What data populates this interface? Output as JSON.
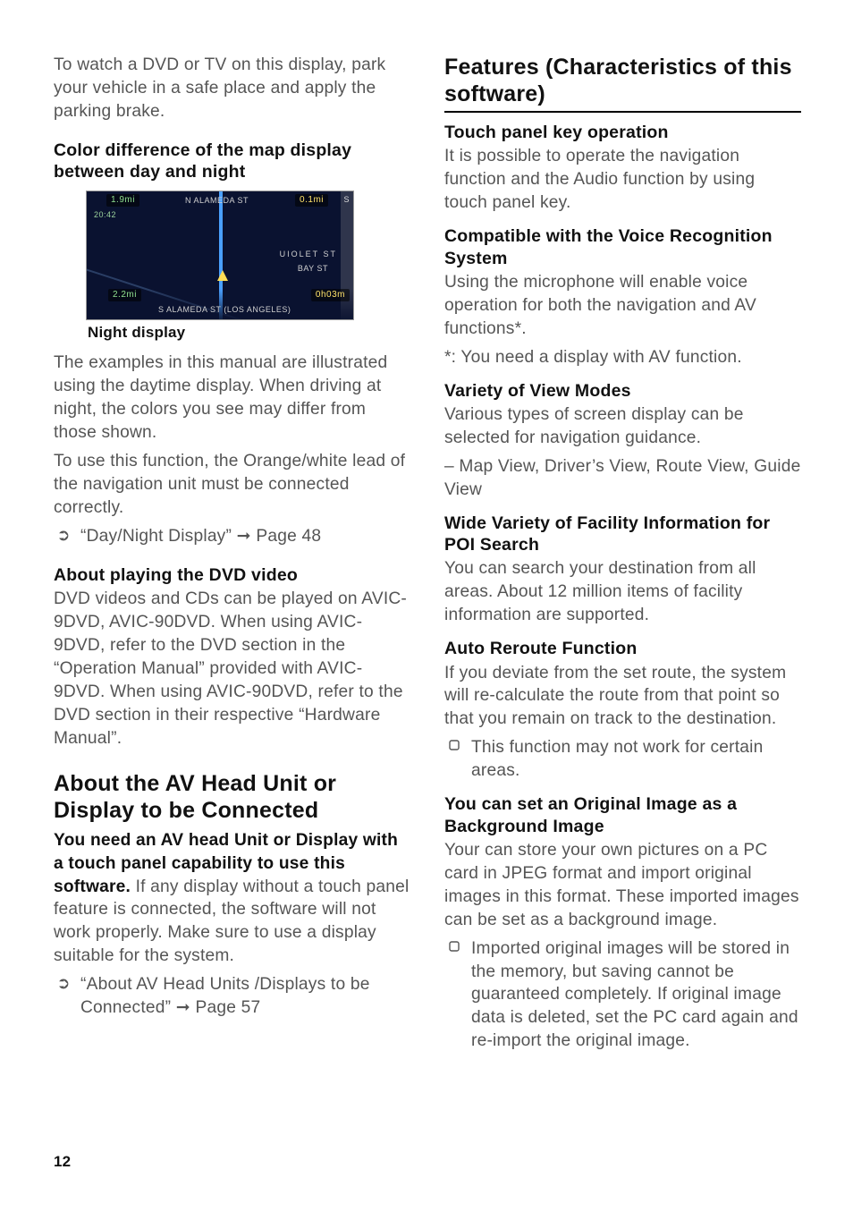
{
  "left": {
    "intro_para": "To watch a DVD or TV on this display, park your vehicle in a safe place and apply the parking brake.",
    "map_section_heading": "Color difference of the map display between day and night",
    "map_overlay": {
      "top_street": "N ALAMEDA ST",
      "bottom_street": "S ALAMEDA ST (LOS ANGELES)",
      "side_street_1": "UIOLET ST",
      "side_street_2": "BAY ST",
      "time_lbl": "20:42",
      "dist_top": "1.9mi",
      "scale_top_right": "0.1mi",
      "letter_s": "S",
      "dist_bottom_left": "2.2mi",
      "eta_bottom_right": "0h03m"
    },
    "map_caption": "Night display",
    "after_map_para_1": "The examples in this manual are illustrated using the daytime display. When driving at night, the colors you see may differ from those shown.",
    "after_map_para_2": "To use this function, the Orange/white lead of the navigation unit must be connected correctly.",
    "ref_1_text": "“Day/Night Display” ➞ Page 48",
    "dvd_heading": "About playing the DVD video",
    "dvd_para": "DVD videos and CDs can be played on AVIC-9DVD, AVIC-90DVD. When using AVIC-9DVD, refer to the DVD section in the “Operation Manual” provided with AVIC-9DVD. When using AVIC-90DVD, refer to the DVD section in their respective “Hardware Manual”.",
    "av_head_heading": "About the AV Head Unit or Display to be Connected",
    "av_bold_intro": "You need an AV head Unit or Display with a touch panel capability to use this software.",
    "av_tail": " If any display without a touch panel feature is connected, the software will not work properly. Make sure to use a display suitable for the system.",
    "ref_2_text": "“About AV Head Units /Displays to be Connected” ➞ Page 57"
  },
  "right": {
    "features_heading": "Features (Characteristics of this software)",
    "touch_heading": "Touch panel key operation",
    "touch_para": "It is possible to operate the navigation function and the Audio function by using touch panel key.",
    "voice_heading": "Compatible with the Voice Recognition System",
    "voice_para_1": "Using the microphone will enable voice operation for both the navigation and AV functions*.",
    "voice_para_2": "*: You need a display with AV function.",
    "view_heading": "Variety of View Modes",
    "view_para_1": "Various types of screen display can be selected for navigation guidance.",
    "view_para_2": "– Map View, Driver’s View, Route View, Guide View",
    "poi_heading": "Wide Variety of Facility Information for POI Search",
    "poi_para": "You can search your destination from all areas. About 12 million items of facility information are supported.",
    "auto_heading": "Auto Reroute Function",
    "auto_para": "If you deviate from the set route, the system will re-calculate the route from that point so that you remain on track to the destination.",
    "auto_note": "This function may not work for certain areas.",
    "bg_heading": "You can set an Original Image as a Background Image",
    "bg_para": "Your can store your own pictures on a PC card in JPEG format and import original images in this format. These imported images can be set as a background image.",
    "bg_note": "Imported original images will be stored in the memory, but saving cannot be guaranteed completely. If original image data is deleted, set the PC card again and re-import the original image."
  },
  "page_number": "12"
}
